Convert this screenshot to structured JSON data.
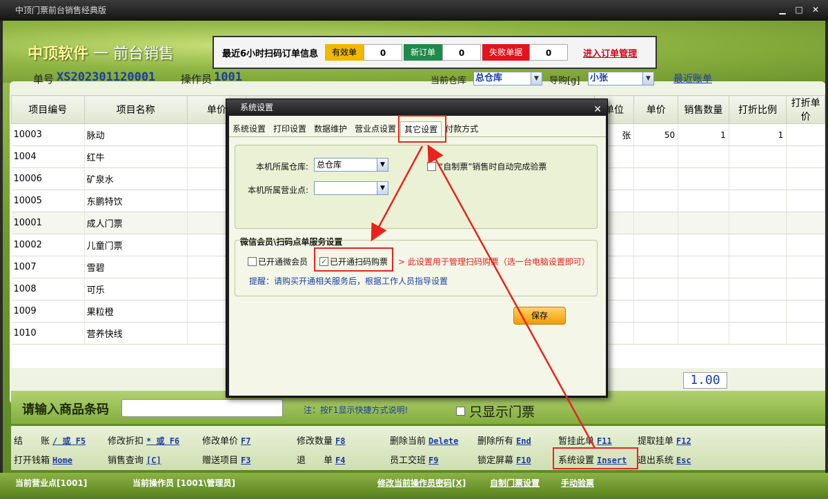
{
  "window": {
    "title": "中顶门票前台销售经典版"
  },
  "brand": {
    "company": "中顶软件",
    "sep": "一",
    "module": "前台销售"
  },
  "scan": {
    "label": "最近6小时扫码订单信息",
    "valid_label": "有效单",
    "valid_count": "0",
    "new_label": "新订单",
    "new_count": "0",
    "fail_label": "失败单据",
    "fail_count": "0",
    "manage_link": "进入订单管理",
    "colors": {
      "valid": "#f0b800",
      "new": "#1f8b4b",
      "fail": "#e1141b"
    }
  },
  "info": {
    "order_label": "单号",
    "order_no": "XS202301120001",
    "operator_label": "操作员",
    "operator_id": "1001",
    "warehouse_label": "当前仓库",
    "warehouse_value": "总仓库",
    "member_label": "导购[g]",
    "member_value": "小张",
    "recent_link": "最近账单"
  },
  "grid": {
    "headers": [
      "项目编号",
      "项目名称",
      "单价",
      "单位",
      "单价",
      "销售数量",
      "打折比例",
      "打折单价"
    ],
    "products": [
      {
        "code": "10003",
        "name": "脉动"
      },
      {
        "code": "1004",
        "name": "红牛"
      },
      {
        "code": "10006",
        "name": "矿泉水"
      },
      {
        "code": "10005",
        "name": "东鹏特饮"
      },
      {
        "code": "10001",
        "name": "成人门票"
      },
      {
        "code": "10002",
        "name": "儿童门票"
      },
      {
        "code": "1007",
        "name": "雪碧"
      },
      {
        "code": "1008",
        "name": "可乐"
      },
      {
        "code": "1009",
        "name": "果粒橙"
      },
      {
        "code": "1010",
        "name": "营养快线"
      }
    ],
    "cart_row": {
      "unit": "张",
      "price": "50",
      "qty": "1",
      "discount": "1"
    },
    "total": "1.00"
  },
  "barcode": {
    "label": "请输入商品条码",
    "note": "注：按F1显示快捷方式说明!",
    "show_ticket": "只显示门票"
  },
  "shortcuts": {
    "row1": [
      {
        "label": "结　　账",
        "key": "/ 或 F5"
      },
      {
        "label": "修改折扣",
        "key": "* 或 F6"
      },
      {
        "label": "修改单价",
        "key": "F7"
      },
      {
        "label": "修改数量",
        "key": "F8"
      },
      {
        "label": "删除当前",
        "key": "Delete"
      },
      {
        "label": "删除所有",
        "key": "End"
      },
      {
        "label": "暂挂此单",
        "key": "F11"
      },
      {
        "label": "提取挂单",
        "key": "F12"
      }
    ],
    "row2": [
      {
        "label": "打开钱箱",
        "key": "Home"
      },
      {
        "label": "销售查询",
        "key": "[C]"
      },
      {
        "label": "赠送项目",
        "key": "F3"
      },
      {
        "label": "退　　单",
        "key": "F4"
      },
      {
        "label": "员工交班",
        "key": "F9"
      },
      {
        "label": "锁定屏幕",
        "key": "F10"
      },
      {
        "label": "系统设置",
        "key": "Insert"
      },
      {
        "label": "退出系统",
        "key": "Esc"
      }
    ]
  },
  "status": {
    "point": "当前营业点[1001]",
    "operator": "当前操作员 [1001\\管理员]",
    "change_pwd": "修改当前操作员密码[X]",
    "custom_ticket": "自制门票设置",
    "manual_check": "手动验票"
  },
  "dialog": {
    "title": "系统设置",
    "tabs": [
      "系统设置",
      "打印设置",
      "数据维护",
      "营业点设置",
      "其它设置",
      "付款方式"
    ],
    "warehouse_label": "本机所属仓库:",
    "warehouse_value": "总仓库",
    "point_label": "本机所属营业点:",
    "point_value": "",
    "self_ticket_label": "“自制票”销售时自动完成验票",
    "group_title": "微信会员\\扫码点单服务设置",
    "wechat_member": "已开通微会员",
    "scan_buy": "已开通扫码购票",
    "scan_note": "> 此设置用于管理扫码购票（选一台电脑设置即可）",
    "hint": "提醒：请购买开通相关服务后，根据工作人员指导设置",
    "save": "保存"
  }
}
